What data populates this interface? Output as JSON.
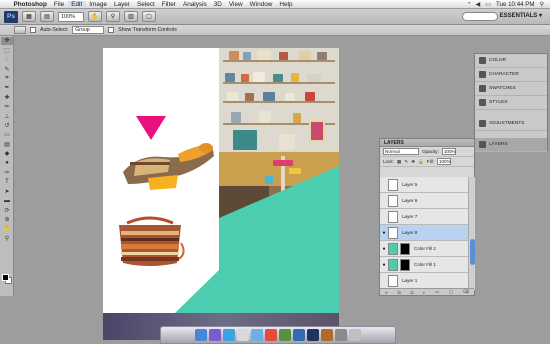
{
  "menubar": {
    "app_name": "Photoshop",
    "items": [
      "File",
      "Edit",
      "Image",
      "Layer",
      "Select",
      "Filter",
      "Analysis",
      "3D",
      "View",
      "Window",
      "Help"
    ],
    "clock": "Tue 10:44 PM"
  },
  "appbar": {
    "badge": "Ps",
    "zoom": "100%",
    "workspace": "ESSENTIALS ▾"
  },
  "options": {
    "auto_select_label": "Auto-Select:",
    "auto_select_value": "Group",
    "show_transform_label": "Show Transform Controls"
  },
  "dock_panels": [
    "COLOR",
    "CHARACTER",
    "SWATCHES",
    "STYLES",
    "ADJUSTMENTS",
    "LAYERS"
  ],
  "layers_panel": {
    "title": "LAYERS",
    "blend_mode": "Normal",
    "opacity_label": "Opacity:",
    "opacity_value": "100%",
    "lock_label": "Lock:",
    "fill_label": "Fill:",
    "fill_value": "100%",
    "layers": [
      {
        "name": "Layer 5"
      },
      {
        "name": "Layer 6"
      },
      {
        "name": "Layer 7"
      },
      {
        "name": "Layer 8"
      },
      {
        "name": "Color Fill 2"
      },
      {
        "name": "Color Fill 1"
      },
      {
        "name": "Layer 1"
      }
    ]
  },
  "colors": {
    "teal": "#4dcdb0",
    "pink": "#e8127e",
    "selection": "#b9d2f1"
  }
}
